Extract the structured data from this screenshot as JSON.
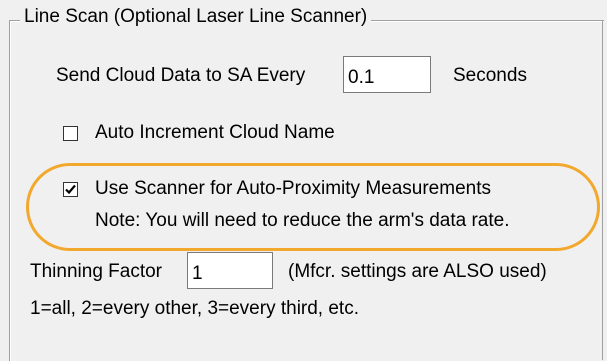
{
  "group": {
    "title": "Line Scan (Optional Laser Line Scanner)"
  },
  "send_cloud": {
    "label": "Send Cloud Data to SA Every",
    "value": "0.1",
    "unit_label": "Seconds"
  },
  "auto_increment": {
    "label": "Auto Increment Cloud Name",
    "checked": false
  },
  "auto_proximity": {
    "label": "Use Scanner for Auto-Proximity Measurements",
    "checked": true,
    "note": "Note: You will need to reduce the arm's data rate."
  },
  "thinning": {
    "label": "Thinning Factor",
    "value": "1",
    "note": "(Mfcr. settings are ALSO used)",
    "help": "1=all, 2=every other, 3=every third, etc."
  },
  "colors": {
    "highlight": "#f2a82c",
    "background": "#f0f0f0"
  }
}
